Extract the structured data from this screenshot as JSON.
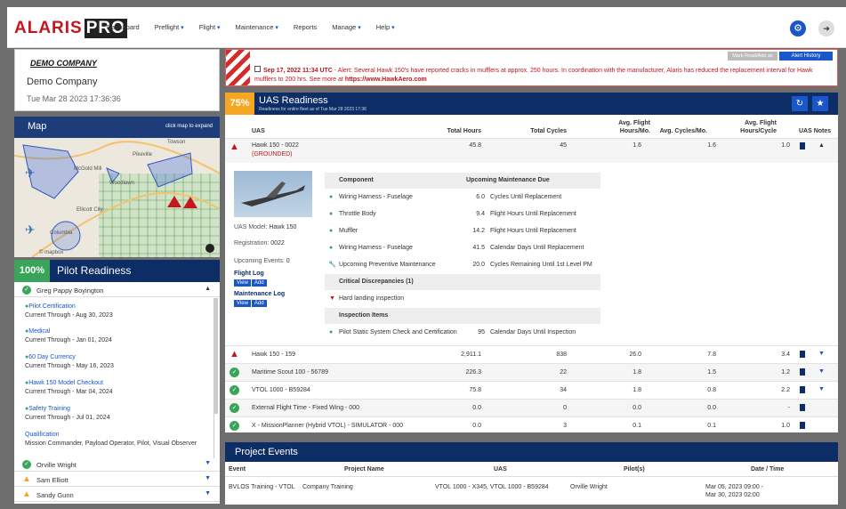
{
  "header": {
    "logo_main": "ALARIS",
    "logo_pro": "PRO",
    "nav": [
      {
        "label": "Dashboard",
        "dropdown": false
      },
      {
        "label": "Preflight",
        "dropdown": true
      },
      {
        "label": "Flight",
        "dropdown": true
      },
      {
        "label": "Maintenance",
        "dropdown": true
      },
      {
        "label": "Reports",
        "dropdown": false
      },
      {
        "label": "Manage",
        "dropdown": true
      },
      {
        "label": "Help",
        "dropdown": true
      }
    ],
    "settings_icon": "gear-icon",
    "logout_icon": "logout-icon"
  },
  "company": {
    "logo_text": "DEMO COMPANY",
    "name": "Demo Company",
    "datetime": "Tue Mar 28 2023 17:36:36"
  },
  "map": {
    "title": "Map",
    "hint": "click map to expand",
    "labels": [
      "Pikeville",
      "Towson",
      "McGold Mill",
      "Woodlawn",
      "Ellicott City",
      "Columbia"
    ],
    "attribution": "© mapbox"
  },
  "pilot_readiness": {
    "percent": "100%",
    "title": "Pilot Readiness",
    "pilots": [
      {
        "name": "Greg Pappy Boyington",
        "status": "ok",
        "expanded": true
      },
      {
        "name": "Orville Wright",
        "status": "ok",
        "expanded": false
      },
      {
        "name": "Sam Elliott",
        "status": "warn",
        "expanded": false
      },
      {
        "name": "Sandy Gunn",
        "status": "warn",
        "expanded": false
      }
    ],
    "certs": [
      {
        "name": "Pilot Certification",
        "sub": "Current Through - Aug 30, 2023"
      },
      {
        "name": "Medical",
        "sub": "Current Through - Jan 01, 2024"
      },
      {
        "name": "60 Day Currency",
        "sub": "Current Through - May 16, 2023"
      },
      {
        "name": "Hawk 150 Model Checkout",
        "sub": "Current Through - Mar 04, 2024"
      },
      {
        "name": "Safety Training",
        "sub": "Current Through - Jul 01, 2024"
      }
    ],
    "qualification_label": "Qualification",
    "qualification": "Mission Commander, Payload Operator, Pilot, Visual Observer"
  },
  "alert": {
    "mark_button": "Mark Read/Add as Read",
    "alert_history": "Alert History",
    "date": "Sep 17, 2022 11:34 UTC",
    "message": " - Alert: Several Hawk 150's have reported cracks in mufflers at approx. 250 hours. In coordination with the manufacturer, Alaris has reduced the replacement interval for Hawk mufflers to 200 hrs. See more at ",
    "link": "https://www.HawkAero.com"
  },
  "uas_readiness": {
    "percent": "75%",
    "title": "UAS Readiness",
    "subtitle": "Readiness for entire fleet as of Tue Mar 28 2023 17:36",
    "columns": [
      "UAS",
      "Total Hours",
      "Total Cycles",
      "Avg. Flight Hours/Mo.",
      "Avg. Cycles/Mo.",
      "Avg. Flight Hours/Cycle",
      "UAS Notes"
    ],
    "rows": [
      {
        "name": "Hawk 150 - 0022",
        "note": "(GROUNDED)",
        "status": "warn",
        "total_hours": "45.8",
        "total_cycles": "45",
        "avg_hours_mo": "1.6",
        "avg_cycles_mo": "1.6",
        "avg_hours_cycle": "1.0",
        "expanded": true
      },
      {
        "name": "Hawk 150 - 159",
        "status": "warn",
        "total_hours": "2,911.1",
        "total_cycles": "838",
        "avg_hours_mo": "26.0",
        "avg_cycles_mo": "7.8",
        "avg_hours_cycle": "3.4",
        "expanded": false
      },
      {
        "name": "Maritime Scout 100 - 56789",
        "status": "ok",
        "total_hours": "226.3",
        "total_cycles": "22",
        "avg_hours_mo": "1.8",
        "avg_cycles_mo": "1.5",
        "avg_hours_cycle": "1.2",
        "expanded": false
      },
      {
        "name": "VTOL 1000 - B59284",
        "status": "ok",
        "total_hours": "75.8",
        "total_cycles": "34",
        "avg_hours_mo": "1.8",
        "avg_cycles_mo": "0.8",
        "avg_hours_cycle": "2.2",
        "expanded": false
      },
      {
        "name": "External Flight Time - Fixed Wing - 000",
        "status": "ok",
        "total_hours": "0.0",
        "total_cycles": "0",
        "avg_hours_mo": "0.0",
        "avg_cycles_mo": "0.0",
        "avg_hours_cycle": "-",
        "expanded": null
      },
      {
        "name": "X - MissionPlanner (Hybrid VTOL) - SIMULATOR - 000",
        "status": "ok",
        "total_hours": "0.0",
        "total_cycles": "3",
        "avg_hours_mo": "0.1",
        "avg_cycles_mo": "0.1",
        "avg_hours_cycle": "1.0",
        "expanded": null
      }
    ],
    "detail": {
      "model_label": "UAS Model:",
      "model": "Hawk 150",
      "reg_label": "Registration:",
      "reg": "0022",
      "upcoming_label": "Upcoming Events:",
      "upcoming": "0",
      "flight_log": "Flight Log",
      "maint_log": "Maintenance Log",
      "view": "View",
      "add": "Add",
      "component_head": "Component",
      "due_head": "Upcoming Maintenance Due",
      "components": [
        {
          "name": "Wiring Harness - Fuselage",
          "value": "6.0",
          "desc": "Cycles Until Replacement",
          "icon": "dot"
        },
        {
          "name": "Throttle Body",
          "value": "9.4",
          "desc": "Flight Hours Until Replacement",
          "icon": "dot"
        },
        {
          "name": "Muffler",
          "value": "14.2",
          "desc": "Flight Hours Until Replacement",
          "icon": "dot"
        },
        {
          "name": "Wiring Harness - Fuselage",
          "value": "41.5",
          "desc": "Calendar Days Until Replacement",
          "icon": "dot"
        },
        {
          "name": "Upcoming Preventive Maintenance",
          "value": "20.0",
          "desc": "Cycles Remaining Until 1st Level PM",
          "icon": "wrench"
        }
      ],
      "critical_head": "Critical Discrepancies (1)",
      "critical": [
        {
          "name": "Hard landing inspection"
        }
      ],
      "inspection_head": "Inspection Items",
      "inspections": [
        {
          "name": "Pilot Static System Check and Certification",
          "value": "95",
          "desc": "Calendar Days Until Inspection"
        }
      ]
    }
  },
  "project_events": {
    "title": "Project Events",
    "columns": [
      "Event",
      "Project Name",
      "UAS",
      "Pilot(s)",
      "Date / Time"
    ],
    "rows": [
      {
        "event": "BVLOS Training - VTOL",
        "project": "Company Training",
        "uas": "VTOL 1000 - X345, VTOL 1000 - B59284",
        "pilots": "Orville Wright",
        "date1": "Mar 05, 2023 09:00 -",
        "date2": "Mar 30, 2023 02:00"
      }
    ]
  }
}
